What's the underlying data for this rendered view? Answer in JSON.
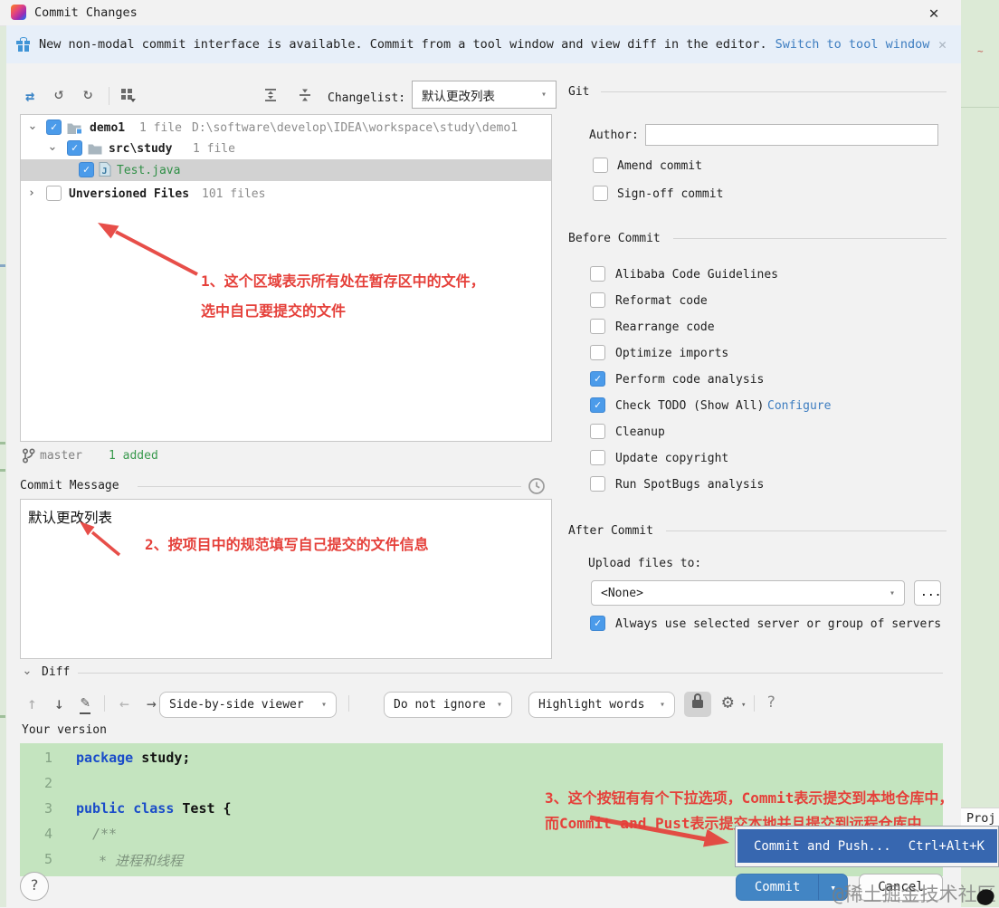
{
  "window": {
    "title": "Commit Changes"
  },
  "icons": {
    "close": "✕",
    "banner_close": "✕",
    "move": "⇄",
    "undo": "↺",
    "refresh": "↻",
    "nav_up": "↑",
    "nav_down": "↓",
    "edit": "✎",
    "nav_back": "←",
    "nav_forward": "→",
    "gear": "⚙",
    "diff_help": "?"
  },
  "banner": {
    "message": "New non-modal commit interface is available. Commit from a tool window and view diff in the editor.",
    "link": "Switch to tool window"
  },
  "toolbar": {
    "changelist_label": "Changelist:",
    "changelist_value": "默认更改列表"
  },
  "tree": {
    "rows": [
      {
        "name": "demo1",
        "meta": "1 file",
        "path": "D:\\software\\develop\\IDEA\\workspace\\study\\demo1",
        "checked": true
      },
      {
        "name": "src\\study",
        "meta": "1 file",
        "checked": true
      },
      {
        "name": "Test.java",
        "checked": true
      },
      {
        "name": "Unversioned Files",
        "meta": "101 files",
        "checked": false
      }
    ]
  },
  "branch": {
    "name": "master",
    "added": "1 added"
  },
  "commit_message": {
    "header": "Commit Message",
    "value": "默认更改列表"
  },
  "git": {
    "header": "Git",
    "author_label": "Author:",
    "amend_label": "Amend commit",
    "signoff_label": "Sign-off commit"
  },
  "before_commit": {
    "header": "Before Commit",
    "items": [
      {
        "label": "Alibaba Code Guidelines",
        "checked": false
      },
      {
        "label": "Reformat code",
        "checked": false
      },
      {
        "label": "Rearrange code",
        "checked": false
      },
      {
        "label": "Optimize imports",
        "checked": false
      },
      {
        "label": "Perform code analysis",
        "checked": true
      },
      {
        "label": "Check TODO (Show All)",
        "link": "Configure",
        "checked": true
      },
      {
        "label": "Cleanup",
        "checked": false
      },
      {
        "label": "Update copyright",
        "checked": false
      },
      {
        "label": "Run SpotBugs analysis",
        "checked": false
      }
    ]
  },
  "after_commit": {
    "header": "After Commit",
    "upload_label": "Upload files to:",
    "upload_value": "<None>",
    "browse_label": "...",
    "always_label": "Always use selected server or group of servers",
    "always_checked": true
  },
  "diff": {
    "header": "Diff",
    "viewer": "Side-by-side viewer",
    "ignore": "Do not ignore",
    "highlight": "Highlight words",
    "your_version": "Your version"
  },
  "code": {
    "lines": [
      {
        "num": "1",
        "kw": "package",
        "rest": " study;"
      },
      {
        "num": "2"
      },
      {
        "num": "3",
        "kw": "public class",
        "rest": " Test {"
      },
      {
        "num": "4",
        "comment": "/**"
      },
      {
        "num": "5",
        "comment": "* 进程和线程"
      }
    ]
  },
  "annotations": {
    "note1_line1": "1、这个区域表示所有处在暂存区中的文件，",
    "note1_line2": "选中自己要提交的文件",
    "note2": "2、按项目中的规范填写自己提交的文件信息",
    "note3_line1": "3、这个按钮有有个下拉选项，Commit表示提交到本地仓库中，",
    "note3_line2": "而Commit and Pust表示提交本地并且提交到远程仓库中"
  },
  "popup": {
    "label": "Commit and Push...",
    "shortcut": "Ctrl+Alt+K"
  },
  "footer": {
    "commit": "Commit",
    "cancel": "Cancel",
    "help": "?"
  },
  "background": {
    "tab": "Proj",
    "watermark": "@稀土掘金技术社区"
  },
  "colors": {
    "accent_blue": "#4285c4",
    "popup_blue": "#3767b0",
    "checkbox_blue": "#4b9bea",
    "annotation_red": "#e5403a",
    "added_green": "#3a9a4e",
    "keyword_blue": "#1a4cc9",
    "code_bg": "#c4e4bf",
    "link_blue": "#3d7dc0"
  }
}
